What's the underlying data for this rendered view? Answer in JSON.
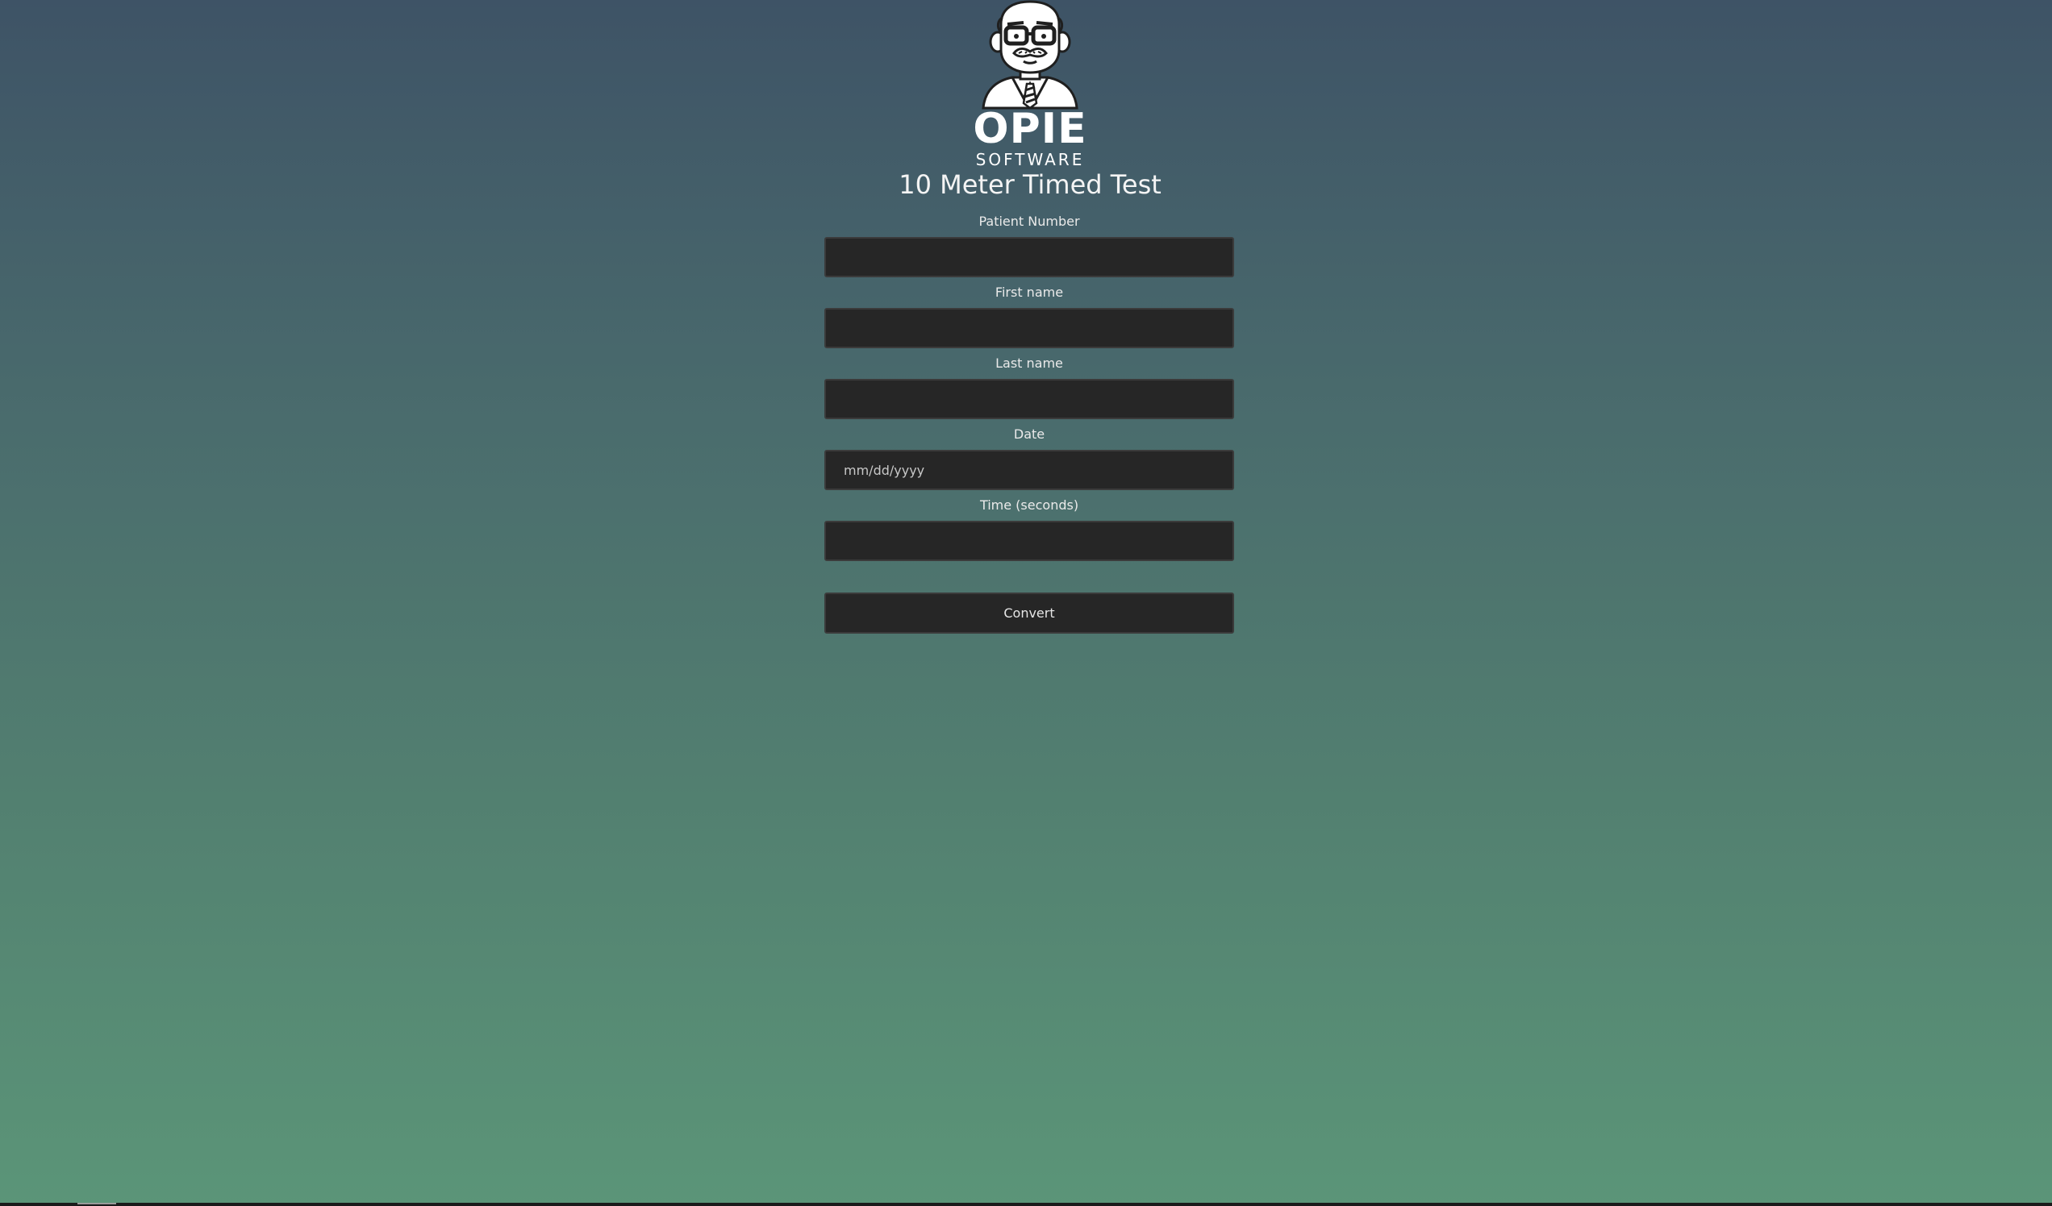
{
  "brand": {
    "logo_icon": "opie-mascot-icon",
    "name": "OPIE",
    "sub": "SOFTWARE"
  },
  "page": {
    "title": "10 Meter Timed Test"
  },
  "form": {
    "patient_number": {
      "label": "Patient Number",
      "value": "",
      "placeholder": ""
    },
    "first_name": {
      "label": "First name",
      "value": "",
      "placeholder": ""
    },
    "last_name": {
      "label": "Last name",
      "value": "",
      "placeholder": ""
    },
    "date": {
      "label": "Date",
      "value": "",
      "placeholder": "mm/dd/yyyy"
    },
    "time_seconds": {
      "label": "Time (seconds)",
      "value": "",
      "placeholder": ""
    },
    "convert_label": "Convert"
  },
  "colors": {
    "gradient_top": "#3e5366",
    "gradient_bottom": "#5b9578",
    "input_background": "#262626",
    "text": "#f2f2f2"
  }
}
